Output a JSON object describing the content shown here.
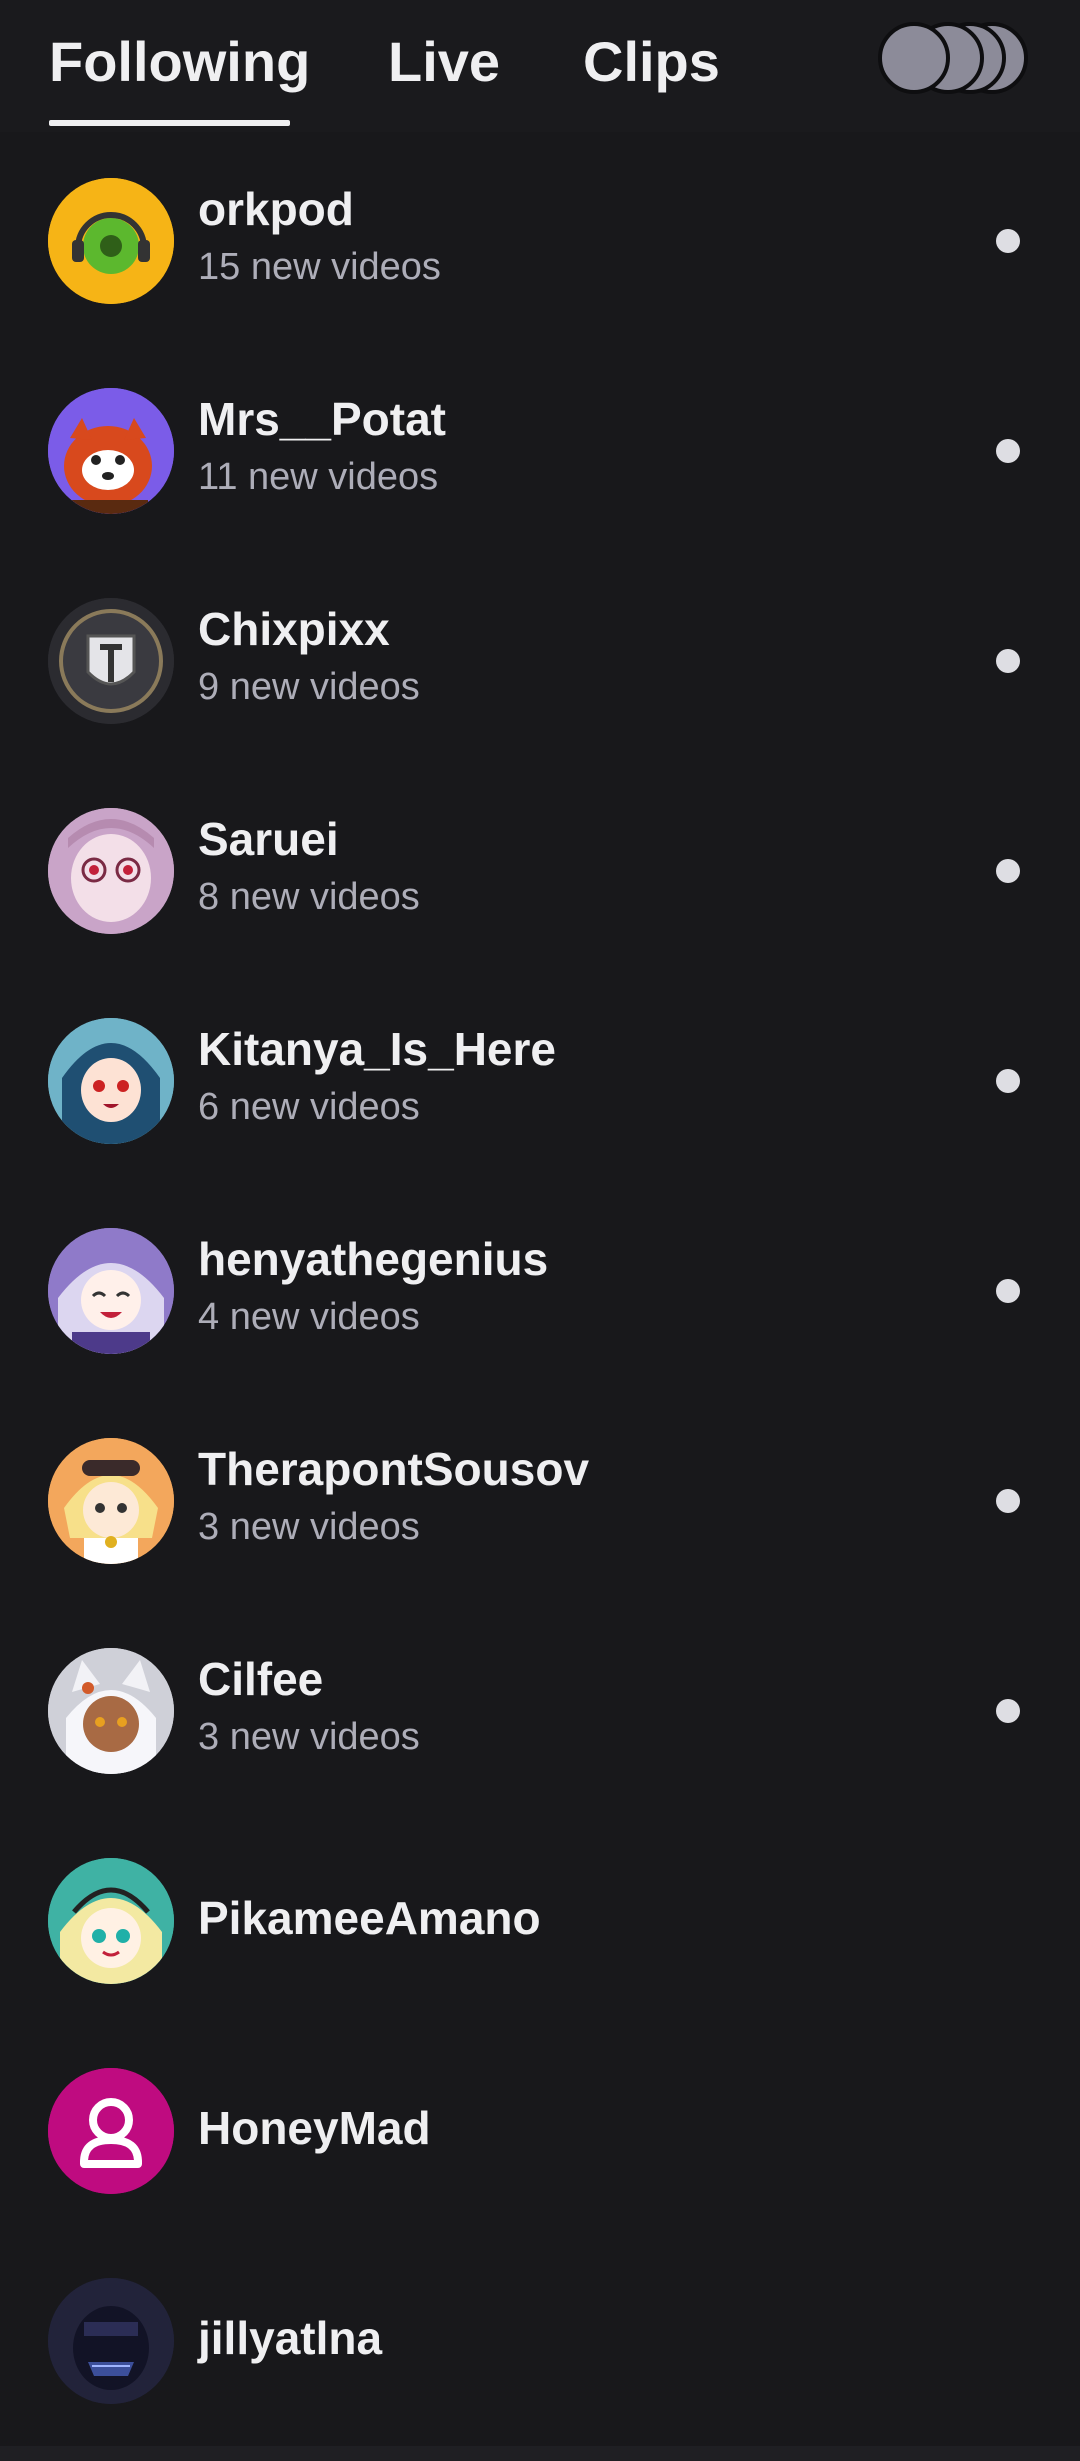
{
  "tabs": {
    "following": "Following",
    "live": "Live",
    "clips": "Clips",
    "active": "following"
  },
  "channels": [
    {
      "name": "orkpod",
      "subtitle": "15 new videos",
      "has_new": true,
      "avatar_icon": "headphones-donut-avatar",
      "avatar_color": "#f6b416"
    },
    {
      "name": "Mrs__Potat",
      "subtitle": "11 new videos",
      "has_new": true,
      "avatar_icon": "red-panda-avatar",
      "avatar_color": "#7b5ce8"
    },
    {
      "name": "Chixpixx",
      "subtitle": "9 new videos",
      "has_new": true,
      "avatar_icon": "shield-crest-avatar",
      "avatar_color": "#2b2b30"
    },
    {
      "name": "Saruei",
      "subtitle": "8 new videos",
      "has_new": true,
      "avatar_icon": "anime-girl-glasses-avatar",
      "avatar_color": "#c9a4c8"
    },
    {
      "name": "Kitanya_Is_Here",
      "subtitle": "6 new videos",
      "has_new": true,
      "avatar_icon": "anime-girl-blue-hair-avatar",
      "avatar_color": "#6fb3c8"
    },
    {
      "name": "henyathegenius",
      "subtitle": "4 new videos",
      "has_new": true,
      "avatar_icon": "anime-girl-purple-avatar",
      "avatar_color": "#8f7ac9"
    },
    {
      "name": "TherapontSousov",
      "subtitle": "3 new videos",
      "has_new": true,
      "avatar_icon": "anime-girl-blonde-avatar",
      "avatar_color": "#f3a75c"
    },
    {
      "name": "Cilfee",
      "subtitle": "3 new videos",
      "has_new": true,
      "avatar_icon": "anime-cat-girl-avatar",
      "avatar_color": "#cfd0d8"
    },
    {
      "name": "PikameeAmano",
      "subtitle": "",
      "has_new": false,
      "avatar_icon": "anime-girl-green-hair-avatar",
      "avatar_color": "#3fb2a4"
    },
    {
      "name": "HoneyMad",
      "subtitle": "",
      "has_new": false,
      "avatar_icon": "default-user-avatar",
      "avatar_color": "#bf0b80"
    },
    {
      "name": "jillyatlna",
      "subtitle": "",
      "has_new": false,
      "avatar_icon": "dark-mask-avatar",
      "avatar_color": "#22233a"
    }
  ],
  "colors": {
    "background": "#18181b",
    "text_primary": "#efeff1",
    "text_secondary": "#adadb8",
    "indicator": "#dedee3"
  }
}
